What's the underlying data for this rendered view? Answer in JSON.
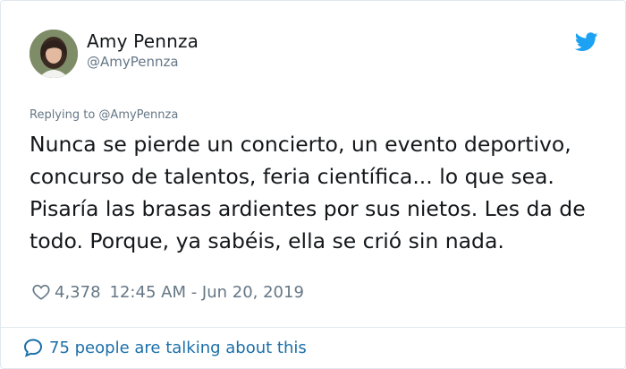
{
  "author": {
    "name": "Amy Pennza",
    "handle": "@AmyPennza",
    "avatar_icon": "profile-photo"
  },
  "tweet": {
    "replying_to": "Replying to @AmyPennza",
    "lines": [
      "Nunca se pierde un concierto, un evento deportivo,",
      "concurso de talentos, feria científica... lo que sea.",
      "Pisaría las brasas ardientes por sus nietos. Les da de",
      "todo. Porque, ya sabéis, ella se crió sin nada."
    ],
    "likes": "4,378",
    "timestamp": "12:45 AM - Jun 20, 2019"
  },
  "footer": {
    "talking": "75 people are talking about this"
  },
  "icons": {
    "bird": "twitter-bird-icon",
    "heart": "heart-icon",
    "bubble": "speech-bubble-icon"
  },
  "colors": {
    "twitter_blue": "#1da1f2",
    "muted": "#657786",
    "link": "#1b6fa8"
  }
}
